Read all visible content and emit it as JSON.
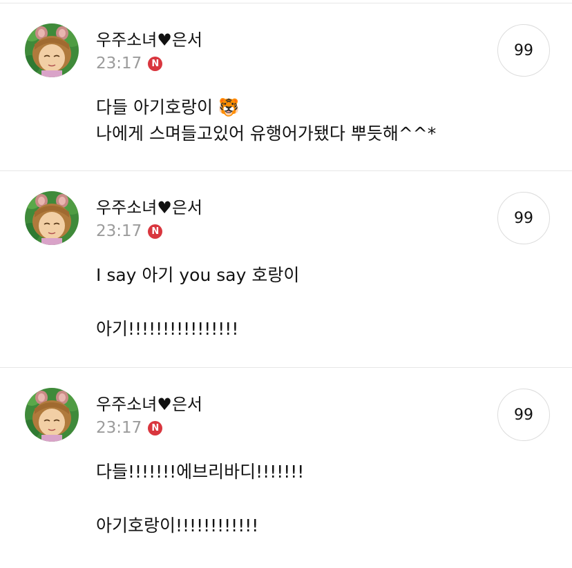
{
  "posts": [
    {
      "username": "우주소녀♥은서",
      "time": "23:17",
      "badge": "N",
      "quote_label": "99",
      "avatar_icon": "cartoon-girl-avatar-icon",
      "lines": [
        "다들 아기호랑이 🐯",
        "나에게 스며들고있어 유행어가됐다 뿌듯해^^*"
      ]
    },
    {
      "username": "우주소녀♥은서",
      "time": "23:17",
      "badge": "N",
      "quote_label": "99",
      "avatar_icon": "cartoon-girl-avatar-icon",
      "lines": [
        "I say 아기 you say 호랑이",
        "아기!!!!!!!!!!!!!!!!"
      ]
    },
    {
      "username": "우주소녀♥은서",
      "time": "23:17",
      "badge": "N",
      "quote_label": "99",
      "avatar_icon": "cartoon-girl-avatar-icon",
      "lines": [
        "다들!!!!!!!에브리바디!!!!!!!",
        "아기호랑이!!!!!!!!!!!!"
      ]
    }
  ],
  "colors": {
    "badge": "#d9363e",
    "time": "#9b9b9b",
    "divider": "#e6e6e6"
  }
}
